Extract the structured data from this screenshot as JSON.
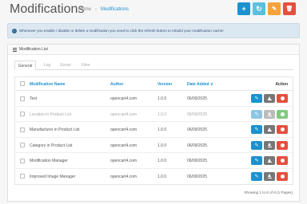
{
  "header": {
    "title": "Modifications",
    "breadcrumb": [
      {
        "label": "Home"
      },
      {
        "label": "Modifications"
      }
    ],
    "buttons": {
      "add": "+",
      "refresh": "↻",
      "clear": "✎",
      "delete": "🗑"
    }
  },
  "alert": {
    "icon": "info-icon",
    "text": "Whenever you enable / disable or delete a modification you need to click the refresh button to rebuild your modification cache!"
  },
  "panel": {
    "title": "Modification List",
    "tabs": [
      {
        "label": "General",
        "active": true
      },
      {
        "label": "Log"
      },
      {
        "label": "Errors"
      },
      {
        "label": "Files"
      }
    ],
    "columns": {
      "name": "Modification Name",
      "author": "Author",
      "version": "Version",
      "date": "Date Added ∨",
      "action": "Action"
    },
    "rows": [
      {
        "name": "Test",
        "author": "opencart4.com",
        "version": "1.0.0",
        "date": "06/09/2025",
        "enabled": true
      },
      {
        "name": "Location in Product List",
        "author": "opencart4.com",
        "version": "1.0.0",
        "date": "06/09/2025",
        "enabled": false
      },
      {
        "name": "Manufacturer in Product List",
        "author": "opencart4.com",
        "version": "1.0.0",
        "date": "06/09/2025",
        "enabled": true
      },
      {
        "name": "Category in Product List",
        "author": "opencart4.com",
        "version": "1.0.0",
        "date": "06/09/2025",
        "enabled": true
      },
      {
        "name": "Modification Manager",
        "author": "opencart4.com",
        "version": "1.0.0",
        "date": "06/09/2025",
        "enabled": true
      },
      {
        "name": "Improved Image Manager",
        "author": "opencart4.com",
        "version": "1.0.0",
        "date": "06/09/2025",
        "enabled": true
      }
    ],
    "footer": "Showing 1 to 6 of 6 (1 Pages)"
  },
  "colors": {
    "primary": "#1e91cf",
    "info": "#5bc0de",
    "warning": "#f7a23b",
    "danger": "#e3503e",
    "success": "#7fc97f"
  }
}
